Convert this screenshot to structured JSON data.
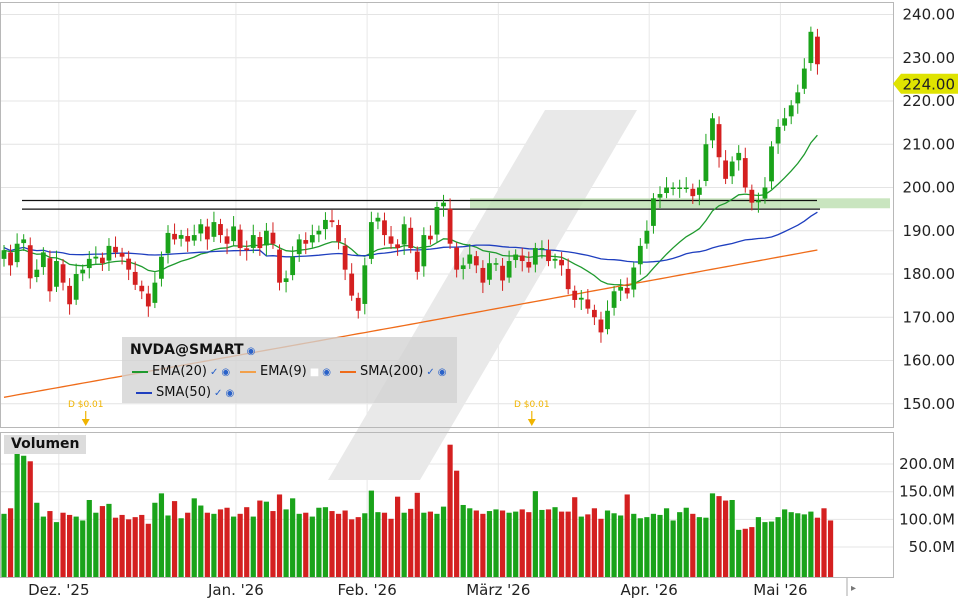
{
  "chart_data": [
    {
      "type": "candlestick",
      "symbol": "NVDA@SMART",
      "ylim": [
        145,
        242
      ],
      "price_ticks": [
        "150.00",
        "160.00",
        "170.00",
        "180.00",
        "190.00",
        "200.00",
        "210.00",
        "220.00",
        "230.00",
        "240.00"
      ],
      "last_price_label": "224.00",
      "x_labels": [
        "Dez. '25",
        "Jan. '26",
        "Feb. '26",
        "März '26",
        "Apr. '26",
        "Mai '26"
      ],
      "dividends": [
        {
          "label": "D $0.01"
        },
        {
          "label": "D $0.01"
        }
      ],
      "legend": [
        {
          "name": "EMA(20)",
          "color": "#1f9a2e"
        },
        {
          "name": "EMA(9)",
          "color": "#f2a04a"
        },
        {
          "name": "SMA(200)",
          "color": "#ef6c1a"
        },
        {
          "name": "SMA(50)",
          "color": "#1f3fbf"
        }
      ],
      "closes": [
        185.5,
        182.0,
        187.0,
        188.0,
        179.0,
        181.0,
        185.0,
        176.0,
        183.0,
        178.0,
        173.0,
        180.0,
        181.0,
        183.5,
        184.0,
        182.5,
        186.5,
        185.0,
        184.0,
        181.0,
        177.5,
        176.0,
        172.5,
        178.0,
        184.0,
        189.5,
        188.0,
        189.0,
        187.5,
        189.0,
        191.5,
        188.0,
        192.0,
        189.0,
        187.0,
        191.0,
        186.0,
        185.5,
        189.0,
        186.0,
        190.0,
        187.0,
        178.0,
        179.0,
        184.0,
        188.0,
        187.0,
        189.0,
        190.0,
        192.5,
        192.0,
        187.5,
        181.0,
        175.0,
        171.5,
        182.0,
        192.0,
        193.0,
        189.0,
        187.0,
        186.0,
        191.5,
        186.0,
        180.5,
        189.0,
        188.0,
        195.5,
        196.5,
        187.0,
        181.0,
        182.0,
        184.5,
        182.0,
        178.0,
        182.5,
        182.5,
        178.5,
        183.0,
        184.5,
        183.0,
        181.5,
        186.0,
        186.0,
        183.0,
        183.5,
        182.0,
        176.5,
        174.0,
        174.5,
        172.0,
        170.0,
        166.5,
        171.5,
        176.0,
        177.0,
        175.5,
        181.5,
        186.5,
        190.0,
        197.5,
        198.5,
        200.0,
        200.0,
        200.0,
        200.0,
        198.0,
        200.0,
        210.0,
        216.0,
        207.0,
        202.0,
        206.0,
        208.0,
        200.0,
        196.5,
        197.0,
        200.0,
        209.5,
        214.0,
        216.0,
        219.0,
        222.0,
        227.5,
        236.0,
        228.5
      ],
      "volume_ticks": [
        "50.0M",
        "100.0M",
        "150.0M",
        "200.0M"
      ],
      "volumes": [
        110,
        120,
        227,
        215,
        205,
        130,
        105,
        115,
        95,
        112,
        108,
        105,
        98,
        135,
        112,
        124,
        128,
        103,
        108,
        100,
        104,
        108,
        92,
        130,
        147,
        107,
        133,
        102,
        112,
        138,
        125,
        112,
        110,
        118,
        121,
        105,
        110,
        122,
        105,
        134,
        132,
        115,
        145,
        118,
        138,
        110,
        112,
        105,
        121,
        122,
        115,
        110,
        116,
        100,
        104,
        111,
        152,
        113,
        112,
        101,
        141,
        112,
        119,
        148,
        112,
        114,
        110,
        123,
        235,
        188,
        126,
        120,
        116,
        110,
        115,
        118,
        116,
        112,
        114,
        118,
        113,
        151,
        117,
        118,
        122,
        114,
        114,
        140,
        105,
        109,
        120,
        101,
        116,
        111,
        107,
        145,
        110,
        102,
        104,
        110,
        108,
        120,
        98,
        113,
        121,
        110,
        104,
        103,
        147,
        142,
        134,
        135,
        81,
        83,
        86,
        104,
        95,
        96,
        104,
        118,
        113,
        111,
        109,
        114,
        103,
        120,
        98
      ]
    }
  ]
}
